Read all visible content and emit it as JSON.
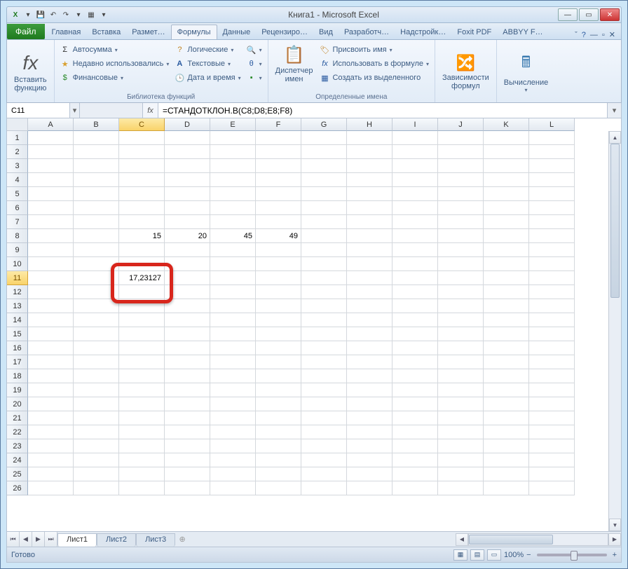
{
  "title": "Книга1 - Microsoft Excel",
  "tabs": {
    "file": "Файл",
    "list": [
      "Главная",
      "Вставка",
      "Размет…",
      "Формулы",
      "Данные",
      "Рецензиро…",
      "Вид",
      "Разработч…",
      "Надстройк…",
      "Foxit PDF",
      "ABBYY F…"
    ],
    "activeIndex": 3
  },
  "ribbon": {
    "insertFn": {
      "label1": "Вставить",
      "label2": "функцию"
    },
    "lib": {
      "autosum": "Автосумма",
      "recent": "Недавно использовались",
      "financial": "Финансовые",
      "logical": "Логические",
      "text": "Текстовые",
      "datetime": "Дата и время",
      "group_title": "Библиотека функций"
    },
    "names": {
      "manager1": "Диспетчер",
      "manager2": "имен",
      "assign": "Присвоить имя",
      "useInFormula": "Использовать в формуле",
      "createFromSel": "Создать из выделенного",
      "group_title": "Определенные имена"
    },
    "audit": {
      "label1": "Зависимости",
      "label2": "формул"
    },
    "calc": {
      "label": "Вычисление"
    }
  },
  "nameBox": "C11",
  "formula": "=СТАНДОТКЛОН.В(C8;D8;E8;F8)",
  "columns": [
    "A",
    "B",
    "C",
    "D",
    "E",
    "F",
    "G",
    "H",
    "I",
    "J",
    "K",
    "L"
  ],
  "rowCount": 26,
  "cells": {
    "C8": "15",
    "D8": "20",
    "E8": "45",
    "F8": "49",
    "C11": "17,23127"
  },
  "activeCell": "C11",
  "sheets": [
    "Лист1",
    "Лист2",
    "Лист3"
  ],
  "activeSheet": 0,
  "status": "Готово",
  "zoom": "100%"
}
